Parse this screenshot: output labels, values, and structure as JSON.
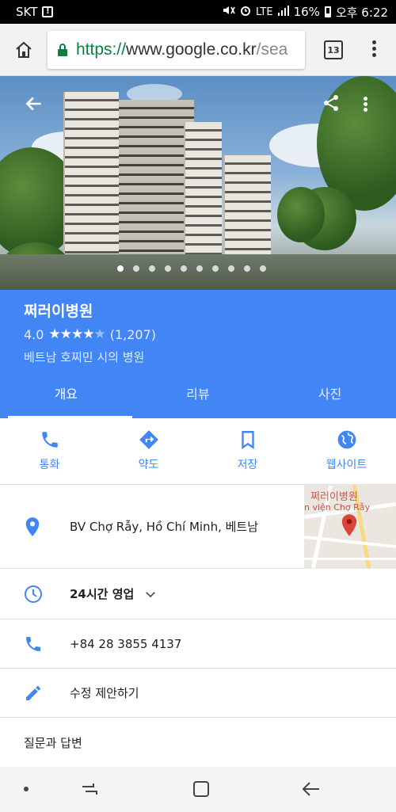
{
  "status_bar": {
    "carrier": "SKT",
    "alert_badge": "!",
    "network": "LTE",
    "battery": "16%",
    "time": "오후 6:22"
  },
  "browser": {
    "url_scheme": "https://",
    "url_host": "www.google.co.kr",
    "url_tail": "/sea",
    "tab_count": "13"
  },
  "place": {
    "name": "쩌러이병원",
    "rating": "4.0",
    "stars_filled": 4,
    "stars_total": 5,
    "review_count": "(1,207)",
    "subtitle": "베트남 호찌민 시의 병원",
    "photo_count": 10,
    "active_photo_index": 0
  },
  "tabs": [
    {
      "label": "개요",
      "active": true
    },
    {
      "label": "리뷰",
      "active": false
    },
    {
      "label": "사진",
      "active": false
    }
  ],
  "actions": [
    {
      "label": "통화",
      "icon": "phone-icon"
    },
    {
      "label": "약도",
      "icon": "directions-icon"
    },
    {
      "label": "저장",
      "icon": "bookmark-icon"
    },
    {
      "label": "웹사이트",
      "icon": "globe-icon"
    }
  ],
  "details": {
    "address": "BV Chợ Rẫy, Hồ Chí Minh, 베트남",
    "hours": "24시간 영업",
    "phone": "+84 28 3855 4137",
    "edit": "수정 제안하기",
    "qa": "질문과 답변"
  },
  "map": {
    "label": "쩌러이병원",
    "sublabel": "n viện Chợ Rẫy"
  },
  "colors": {
    "accent": "#4285f4",
    "url_secure": "#0b8043",
    "pin": "#db4437"
  }
}
